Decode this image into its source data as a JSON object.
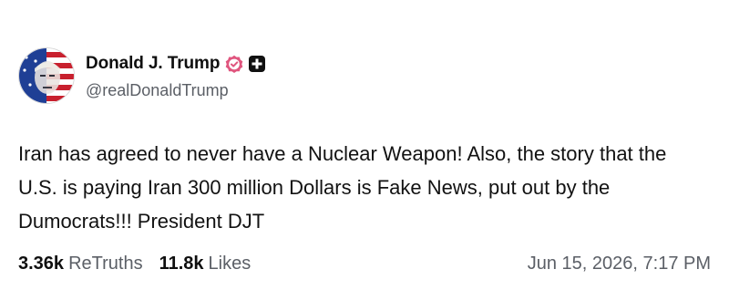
{
  "author": {
    "display_name": "Donald J. Trump",
    "handle": "@realDonaldTrump",
    "verified_icon": "verified-badge-icon",
    "plus_icon": "plus-badge-icon",
    "verified_color": "#e0557e"
  },
  "post": {
    "text": "Iran has agreed to never have a Nuclear Weapon! Also, the story that the U.S. is paying Iran 300 million Dollars is Fake News, put out by the Dumocrats!!! President DJT"
  },
  "stats": {
    "retruths_count": "3.36k",
    "retruths_label": "ReTruths",
    "likes_count": "11.8k",
    "likes_label": "Likes"
  },
  "timestamp": "Jun 15, 2026, 7:17 PM"
}
